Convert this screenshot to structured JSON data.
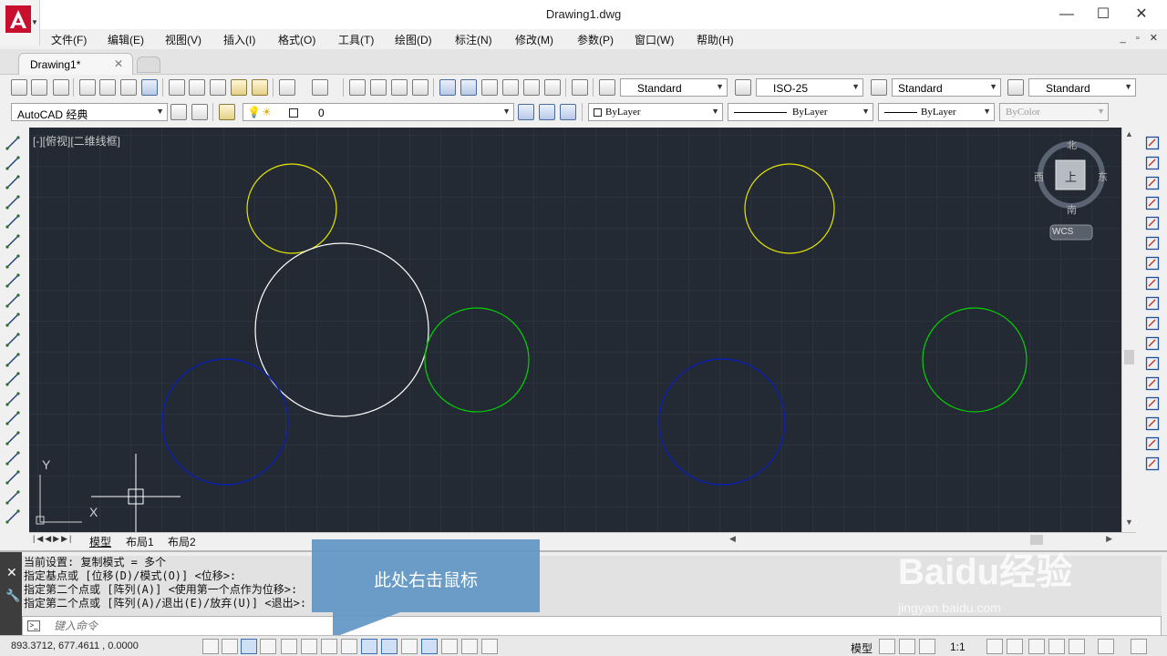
{
  "window": {
    "title": "Drawing1.dwg",
    "controls": [
      "—",
      "☐",
      "✕"
    ]
  },
  "menu": [
    "文件(F)",
    "编辑(E)",
    "视图(V)",
    "插入(I)",
    "格式(O)",
    "工具(T)",
    "绘图(D)",
    "标注(N)",
    "修改(M)",
    "参数(P)",
    "窗口(W)",
    "帮助(H)"
  ],
  "mdi_controls": "_ ▫ ✕",
  "tabs": {
    "doc_tab": "Drawing1*",
    "close": "✕"
  },
  "styles_toolbar": {
    "text_style": "Standard",
    "dim_style": "ISO-25",
    "table_style": "Standard",
    "multileader_style": "Standard"
  },
  "workspace": "AutoCAD 经典",
  "layer": "0",
  "properties": {
    "color": "ByLayer",
    "linetype": "ByLayer",
    "lineweight": "ByLayer",
    "plotstyle": "ByColor"
  },
  "viewport_label": "[-][俯视][二维线框]",
  "viewcube": {
    "north": "北",
    "south": "南",
    "east": "东",
    "west": "西",
    "top": "上",
    "wcs": "WCS"
  },
  "ucs": {
    "x": "X",
    "y": "Y"
  },
  "drawing_colors": {
    "background": "#232a34",
    "yellow": "#e6e600",
    "white": "#ffffff",
    "green": "#00d400",
    "blue": "#0a1fb0"
  },
  "layout_tabs": [
    "模型",
    "布局1",
    "布局2"
  ],
  "command_history": [
    "当前设置:  复制模式 = 多个",
    "指定基点或 [位移(D)/模式(O)] <位移>:",
    "指定第二个点或 [阵列(A)] <使用第一个点作为位移>:",
    "指定第二个点或 [阵列(A)/退出(E)/放弃(U)] <退出>:"
  ],
  "command_input_placeholder": "键入命令",
  "callout_text": "此处右击鼠标",
  "statusbar": {
    "coords": "893.3712,  677.4611 , 0.0000",
    "model": "模型",
    "scale": "1:1"
  },
  "watermark": {
    "brand": "Baidu经验",
    "url": "jingyan.baidu.com"
  }
}
